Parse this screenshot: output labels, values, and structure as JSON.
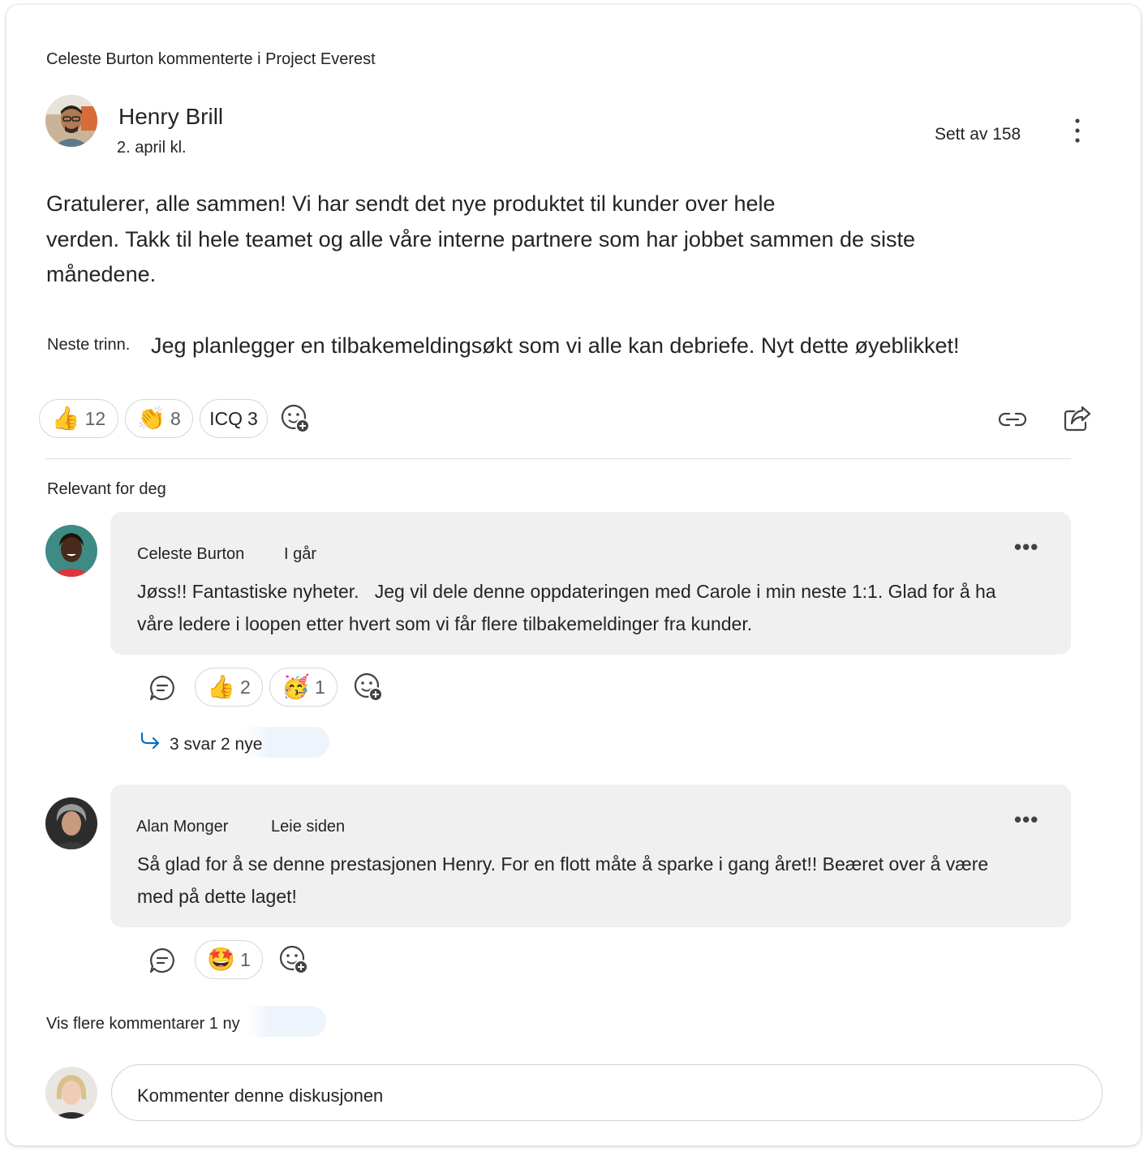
{
  "post": {
    "activity": "Celeste Burton kommenterte i Project Everest",
    "author": "Henry Brill",
    "date": "2. april kl.",
    "seen_by": "Sett av 158",
    "body_line1": "Gratulerer, alle sammen! Vi har sendt det nye produktet til kunder over hele",
    "body_line2": "verden. Takk til hele teamet og alle våre interne partnere som har jobbet sammen de siste",
    "body_line3": "månedene.",
    "next_label": "Neste trinn.",
    "next_text": "Jeg planlegger en tilbakemeldingsøkt som vi alle kan debriefe. Nyt dette øyeblikket!",
    "reactions": [
      {
        "emoji": "👍",
        "count": "12"
      },
      {
        "emoji": "👏",
        "count": "8"
      },
      {
        "emoji": "ICQ",
        "count": "3"
      }
    ]
  },
  "section_label": "Relevant for deg",
  "comments": [
    {
      "author": "Celeste Burton",
      "time": "I går",
      "line1": "Jøss!! Fantastiske nyheter.   Jeg vil dele denne oppdateringen med Carole i min neste 1:1. Glad for å ha",
      "line2": "våre ledere i loopen etter hvert som vi får flere tilbakemeldinger fra kunder.",
      "reactions": [
        {
          "emoji": "👍",
          "count": "2"
        },
        {
          "emoji": "🥳",
          "count": "1"
        }
      ],
      "replies": "3 svar 2 nye"
    },
    {
      "author": "Alan Monger",
      "time": "Leie siden",
      "line1": "Så glad for å se denne prestasjonen Henry. For en flott måte å sparke i gang året!! Beæret over å være",
      "line2": "med på dette laget!",
      "reactions": [
        {
          "emoji": "🤩",
          "count": "1"
        }
      ]
    }
  ],
  "more_comments": "Vis flere kommentarer 1 ny",
  "composer": {
    "placeholder": "Kommenter denne diskusjonen"
  },
  "colors": {
    "accent": "#0f6cbd",
    "bubble": "#f0f0f0",
    "text": "#242424"
  }
}
